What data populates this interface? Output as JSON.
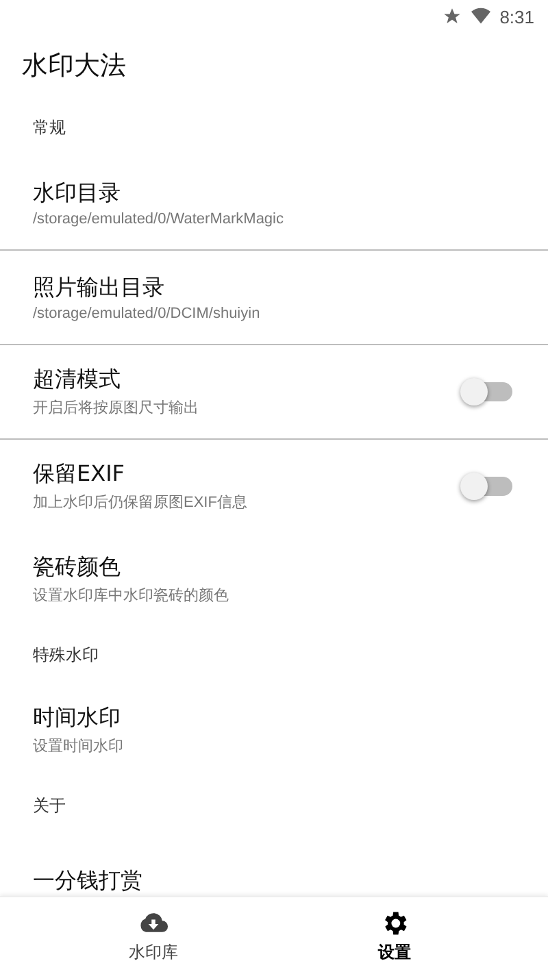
{
  "status_bar": {
    "time": "8:31"
  },
  "app_bar": {
    "title": "水印大法"
  },
  "sections": [
    {
      "header": "常规",
      "items": [
        {
          "kind": "link",
          "title": "水印目录",
          "subtitle": "/storage/emulated/0/WaterMarkMagic",
          "divider_below": true
        },
        {
          "kind": "link",
          "title": "照片输出目录",
          "subtitle": "/storage/emulated/0/DCIM/shuiyin",
          "divider_below": true
        },
        {
          "kind": "switch",
          "title": "超清模式",
          "subtitle": "开启后将按原图尺寸输出",
          "on": false,
          "divider_below": true
        },
        {
          "kind": "switch",
          "title": "保留EXIF",
          "subtitle": "加上水印后仍保留原图EXIF信息",
          "on": false,
          "divider_below": false
        },
        {
          "kind": "link",
          "title": "瓷砖颜色",
          "subtitle": "设置水印库中水印瓷砖的颜色",
          "divider_below": false
        }
      ]
    },
    {
      "header": "特殊水印",
      "items": [
        {
          "kind": "link",
          "title": "时间水印",
          "subtitle": "设置时间水印",
          "divider_below": false
        }
      ]
    },
    {
      "header": "关于",
      "items": [
        {
          "kind": "link",
          "title": "一分钱打赏",
          "divider_below": false
        }
      ]
    }
  ],
  "bottom_nav": [
    {
      "kind": "cloud",
      "label": "水印库",
      "selected": false
    },
    {
      "kind": "gear",
      "label": "设置",
      "selected": true
    }
  ]
}
